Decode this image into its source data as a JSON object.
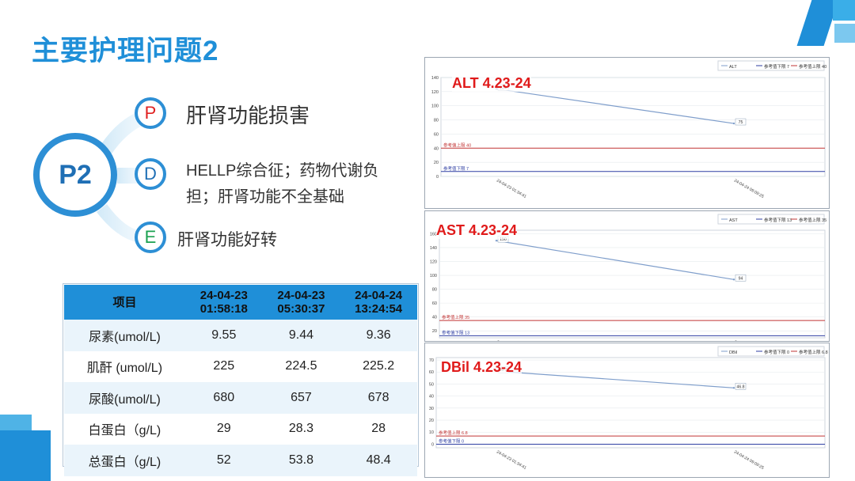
{
  "title": "主要护理问题2",
  "hub_label": "P2",
  "nodes": [
    {
      "letter": "P",
      "text": "肝肾功能损害"
    },
    {
      "letter": "D",
      "text": "HELLP综合征；药物代谢负担；肝肾功能不全基础"
    },
    {
      "letter": "E",
      "text": "肝肾功能好转"
    }
  ],
  "table": {
    "headers": [
      "项目",
      "24-04-23 01:58:18",
      "24-04-23 05:30:37",
      "24-04-24 13:24:54"
    ],
    "rows": [
      [
        "尿素(umol/L)",
        "9.55",
        "9.44",
        "9.36"
      ],
      [
        "肌酐 (umol/L)",
        "225",
        "224.5",
        "225.2"
      ],
      [
        "尿酸(umol/L)",
        "680",
        "657",
        "678"
      ],
      [
        "白蛋白（g/L)",
        "29",
        "28.3",
        "28"
      ],
      [
        "总蛋白（g/L)",
        "52",
        "53.8",
        "48.4"
      ]
    ]
  },
  "colors": {
    "accent": "#1f8fd8",
    "hub_ring": "#2d8fd5",
    "p_letter": "#e02020",
    "d_letter": "#1f6fb5",
    "e_letter": "#1aa150",
    "chart_title": "#e01a1a",
    "series_line": "#7f9ecb",
    "lower_ref": "#2f3fa3",
    "upper_ref": "#c23434"
  },
  "chart_data": [
    {
      "type": "line",
      "title": "ALT 4.23-24",
      "x": [
        "24-04-23 01:34:41",
        "24-04-24 09:09:25"
      ],
      "series": [
        {
          "name": "ALT",
          "values": [
            124,
            75
          ]
        }
      ],
      "reference_lines": [
        {
          "name": "参考值下限",
          "value": 7,
          "label": "参考值下限 7"
        },
        {
          "name": "参考值上限",
          "value": 40,
          "label": "参考值上限 40"
        }
      ],
      "legend": [
        "ALT",
        "参考值下限 7",
        "参考值上限 40"
      ],
      "yticks": [
        0,
        20,
        40,
        60,
        80,
        100,
        120,
        140
      ],
      "ylim": [
        0,
        140
      ],
      "grid": true,
      "legend_position": "top-right"
    },
    {
      "type": "line",
      "title": "AST 4.23-24",
      "x": [
        "24-04-23 01:34:41",
        "24-04-24 09:09:25"
      ],
      "series": [
        {
          "name": "AST",
          "values": [
            150,
            94
          ]
        }
      ],
      "reference_lines": [
        {
          "name": "参考值下限",
          "value": 13,
          "label": "参考值下限 13"
        },
        {
          "name": "参考值上限",
          "value": 35,
          "label": "参考值上限 35"
        }
      ],
      "legend": [
        "AST",
        "参考值下限 13",
        "参考值上限 35"
      ],
      "yticks": [
        20,
        40,
        60,
        80,
        100,
        120,
        140,
        160
      ],
      "ylim": [
        10,
        165
      ],
      "grid": true,
      "legend_position": "top-right"
    },
    {
      "type": "line",
      "title": "DBil 4.23-24",
      "x": [
        "24-04-23 01:34:41",
        "24-04-24 09:09:25"
      ],
      "series": [
        {
          "name": "DBil",
          "values": [
            60.7,
            46.8
          ]
        }
      ],
      "reference_lines": [
        {
          "name": "参考值下限",
          "value": 0,
          "label": "参考值下限 0"
        },
        {
          "name": "参考值上限",
          "value": 6.8,
          "label": "参考值上限 6.8"
        }
      ],
      "legend": [
        "DBil",
        "参考值下限 0",
        "参考值上限 6.8"
      ],
      "yticks": [
        0,
        10,
        20,
        30,
        40,
        50,
        60,
        70
      ],
      "ylim": [
        -3,
        72
      ],
      "grid": true,
      "legend_position": "top-right"
    }
  ]
}
